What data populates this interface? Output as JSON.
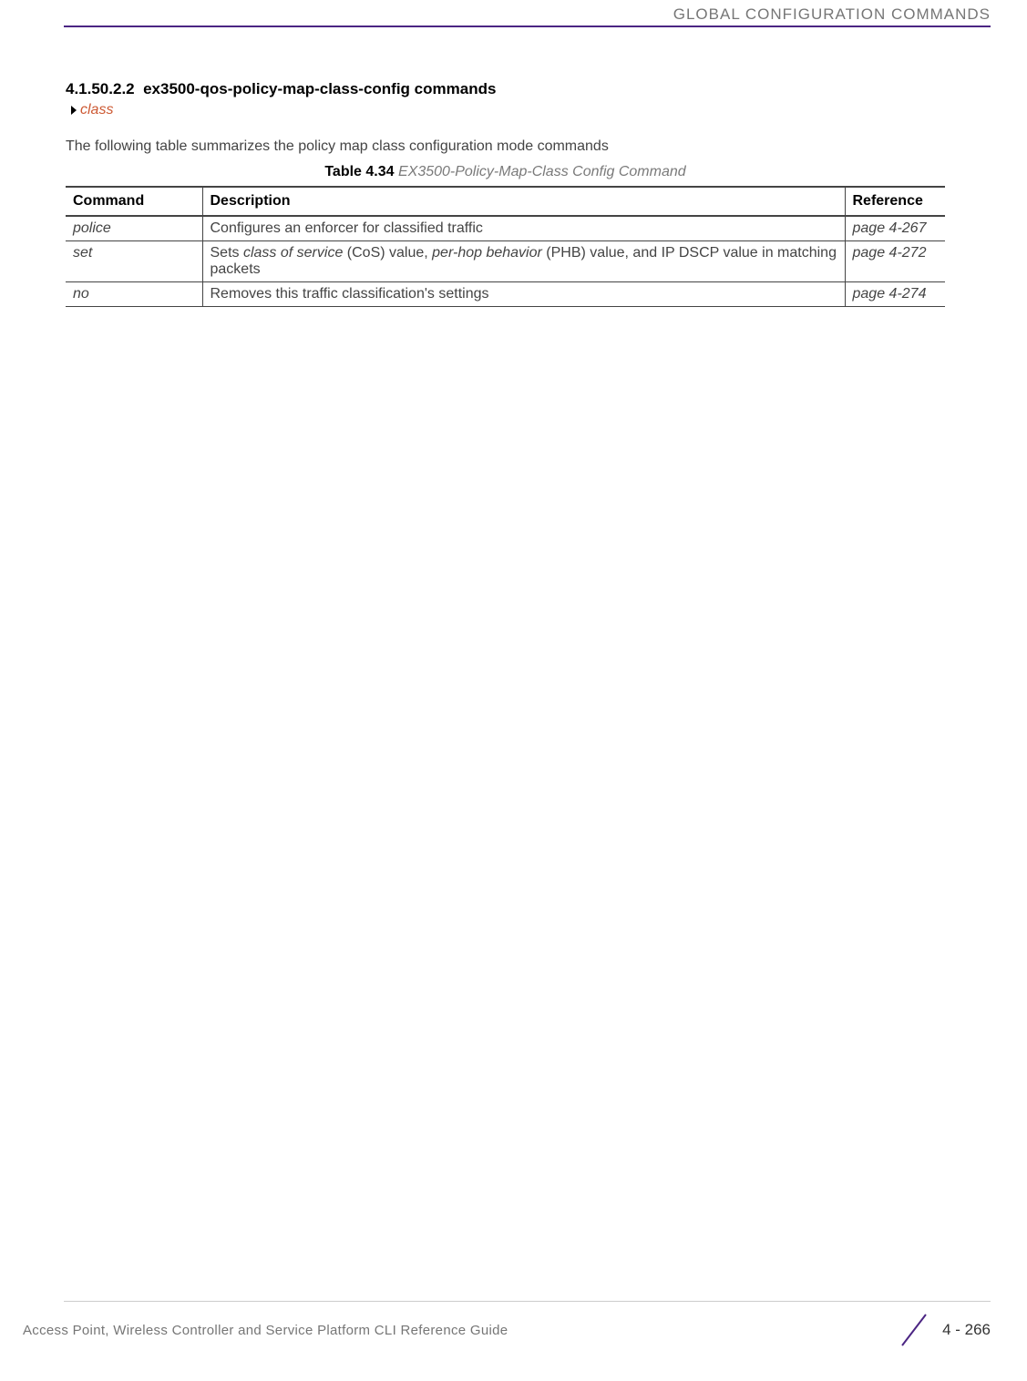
{
  "header": {
    "title": "GLOBAL CONFIGURATION COMMANDS"
  },
  "section": {
    "number": "4.1.50.2.2",
    "title": "ex3500-qos-policy-map-class-config commands",
    "breadcrumb": "class",
    "intro": "The following table summarizes the policy map class configuration mode commands"
  },
  "table": {
    "caption_label": "Table 4.34",
    "caption_title": "EX3500-Policy-Map-Class Config Command",
    "headers": {
      "command": "Command",
      "description": "Description",
      "reference": "Reference"
    },
    "rows": [
      {
        "command": "police",
        "description_html": "Configures an enforcer for classified traffic",
        "reference": "page 4-267"
      },
      {
        "command": "set",
        "description_html": "Sets <span class=\"ital\">class of service</span> (CoS) value, <span class=\"ital\">per-hop behavior</span> (PHB) value, and IP DSCP value in matching packets",
        "reference": "page 4-272"
      },
      {
        "command": "no",
        "description_html": "Removes this traffic classification's settings",
        "reference": "page 4-274"
      }
    ]
  },
  "footer": {
    "guide": "Access Point, Wireless Controller and Service Platform CLI Reference Guide",
    "page": "4 - 266"
  }
}
